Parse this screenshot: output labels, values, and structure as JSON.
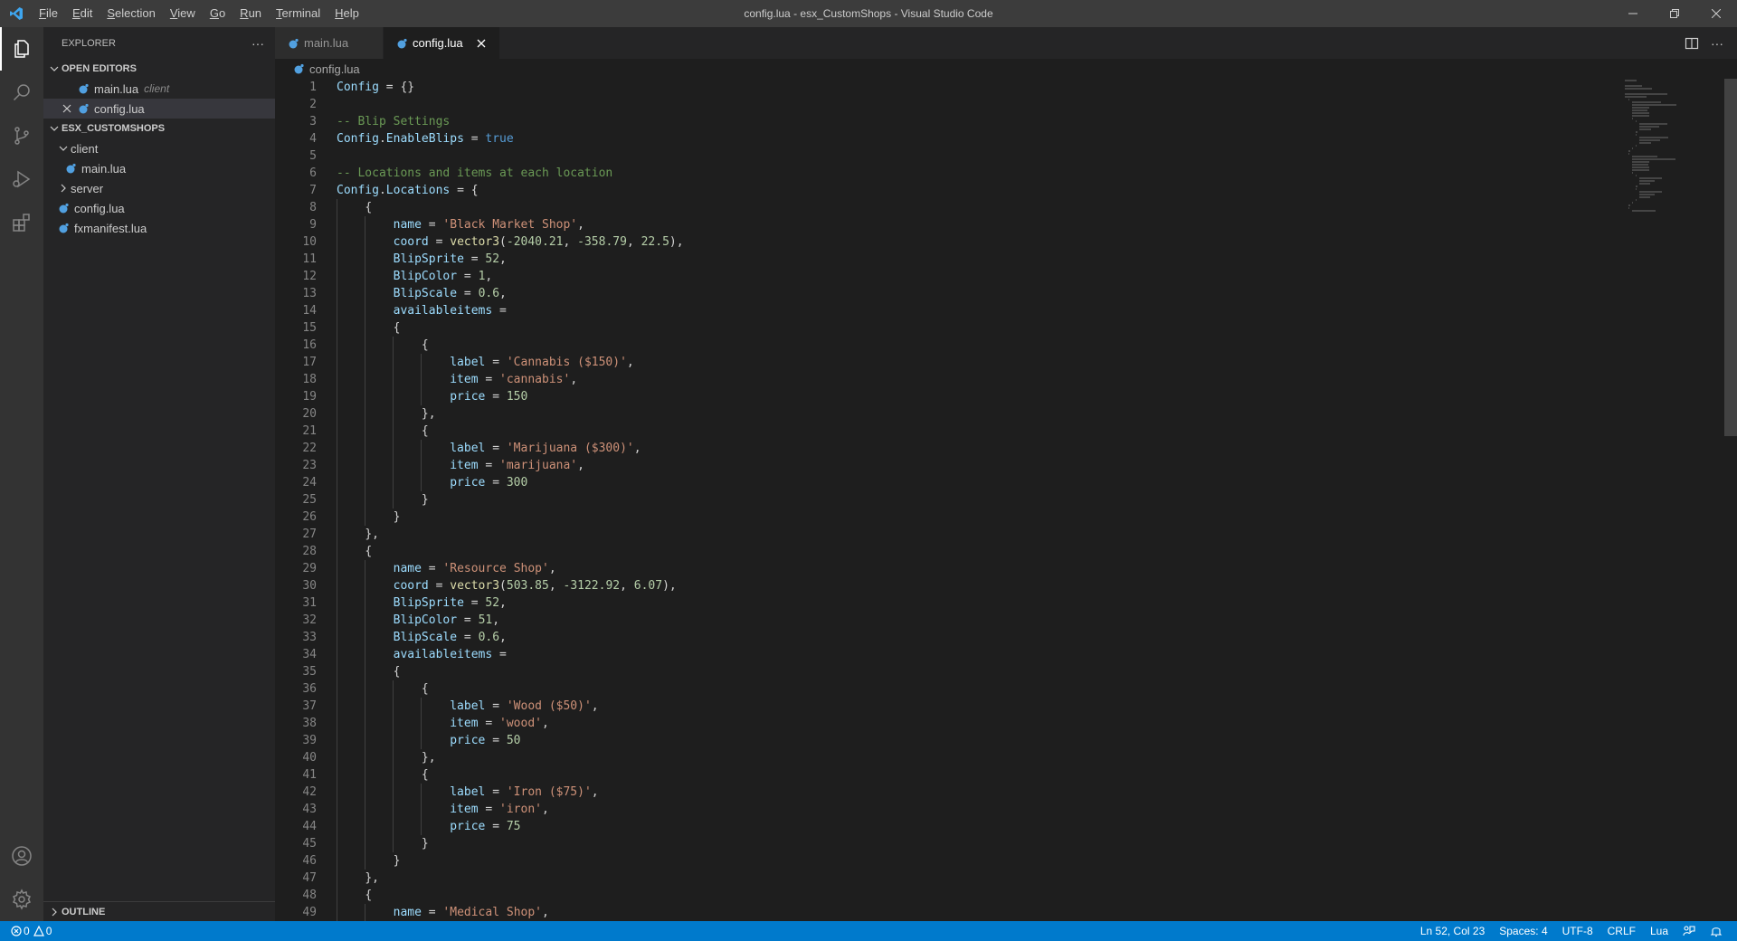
{
  "window": {
    "title": "config.lua - esx_CustomShops - Visual Studio Code",
    "accent": "#007acc"
  },
  "menu": [
    {
      "u": "F",
      "rest": "ile"
    },
    {
      "u": "E",
      "rest": "dit"
    },
    {
      "u": "S",
      "rest": "election"
    },
    {
      "u": "V",
      "rest": "iew"
    },
    {
      "u": "G",
      "rest": "o"
    },
    {
      "u": "R",
      "rest": "un"
    },
    {
      "u": "T",
      "rest": "erminal"
    },
    {
      "u": "H",
      "rest": "elp"
    }
  ],
  "sidebar": {
    "header": "EXPLORER",
    "open_editors_label": "OPEN EDITORS",
    "open_editors": [
      {
        "name": "main.lua",
        "desc": "client"
      },
      {
        "name": "config.lua",
        "desc": ""
      }
    ],
    "workspace_label": "ESX_CUSTOMSHOPS",
    "tree": {
      "client_folder": "client",
      "client_main": "main.lua",
      "server_folder": "server",
      "config": "config.lua",
      "fxmanifest": "fxmanifest.lua"
    },
    "outline_label": "OUTLINE"
  },
  "tabs": [
    {
      "label": "main.lua",
      "active": false
    },
    {
      "label": "config.lua",
      "active": true
    }
  ],
  "breadcrumb": "config.lua",
  "editor": {
    "lines": [
      {
        "indent": 0,
        "tokens": [
          [
            "v",
            "Config"
          ],
          [
            "p",
            " = {}"
          ]
        ]
      },
      {
        "indent": 0,
        "tokens": []
      },
      {
        "indent": 0,
        "tokens": [
          [
            "c",
            "-- Blip Settings"
          ]
        ]
      },
      {
        "indent": 0,
        "tokens": [
          [
            "v",
            "Config"
          ],
          [
            "p",
            "."
          ],
          [
            "f",
            "EnableBlips"
          ],
          [
            "p",
            " = "
          ],
          [
            "k",
            "true"
          ]
        ]
      },
      {
        "indent": 0,
        "tokens": []
      },
      {
        "indent": 0,
        "tokens": [
          [
            "c",
            "-- Locations and items at each location"
          ]
        ]
      },
      {
        "indent": 0,
        "tokens": [
          [
            "v",
            "Config"
          ],
          [
            "p",
            "."
          ],
          [
            "f",
            "Locations"
          ],
          [
            "p",
            " = {"
          ]
        ]
      },
      {
        "indent": 1,
        "tokens": [
          [
            "p",
            "{"
          ]
        ]
      },
      {
        "indent": 2,
        "tokens": [
          [
            "v",
            "name"
          ],
          [
            "p",
            " = "
          ],
          [
            "s",
            "'Black Market Shop'"
          ],
          [
            "p",
            ","
          ]
        ]
      },
      {
        "indent": 2,
        "tokens": [
          [
            "v",
            "coord"
          ],
          [
            "p",
            " = "
          ],
          [
            "fn",
            "vector3"
          ],
          [
            "p",
            "("
          ],
          [
            "n",
            "-2040.21"
          ],
          [
            "p",
            ", "
          ],
          [
            "n",
            "-358.79"
          ],
          [
            "p",
            ", "
          ],
          [
            "n",
            "22.5"
          ],
          [
            "p",
            "),"
          ]
        ]
      },
      {
        "indent": 2,
        "tokens": [
          [
            "v",
            "BlipSprite"
          ],
          [
            "p",
            " = "
          ],
          [
            "n",
            "52"
          ],
          [
            "p",
            ","
          ]
        ]
      },
      {
        "indent": 2,
        "tokens": [
          [
            "v",
            "BlipColor"
          ],
          [
            "p",
            " = "
          ],
          [
            "n",
            "1"
          ],
          [
            "p",
            ","
          ]
        ]
      },
      {
        "indent": 2,
        "tokens": [
          [
            "v",
            "BlipScale"
          ],
          [
            "p",
            " = "
          ],
          [
            "n",
            "0.6"
          ],
          [
            "p",
            ","
          ]
        ]
      },
      {
        "indent": 2,
        "tokens": [
          [
            "v",
            "availableitems"
          ],
          [
            "p",
            " ="
          ]
        ]
      },
      {
        "indent": 2,
        "tokens": [
          [
            "p",
            "{"
          ]
        ]
      },
      {
        "indent": 3,
        "tokens": [
          [
            "p",
            "{"
          ]
        ]
      },
      {
        "indent": 4,
        "tokens": [
          [
            "v",
            "label"
          ],
          [
            "p",
            " = "
          ],
          [
            "s",
            "'Cannabis ($150)'"
          ],
          [
            "p",
            ","
          ]
        ]
      },
      {
        "indent": 4,
        "tokens": [
          [
            "v",
            "item"
          ],
          [
            "p",
            " = "
          ],
          [
            "s",
            "'cannabis'"
          ],
          [
            "p",
            ","
          ]
        ]
      },
      {
        "indent": 4,
        "tokens": [
          [
            "v",
            "price"
          ],
          [
            "p",
            " = "
          ],
          [
            "n",
            "150"
          ]
        ]
      },
      {
        "indent": 3,
        "tokens": [
          [
            "p",
            "},"
          ]
        ]
      },
      {
        "indent": 3,
        "tokens": [
          [
            "p",
            "{"
          ]
        ]
      },
      {
        "indent": 4,
        "tokens": [
          [
            "v",
            "label"
          ],
          [
            "p",
            " = "
          ],
          [
            "s",
            "'Marijuana ($300)'"
          ],
          [
            "p",
            ","
          ]
        ]
      },
      {
        "indent": 4,
        "tokens": [
          [
            "v",
            "item"
          ],
          [
            "p",
            " = "
          ],
          [
            "s",
            "'marijuana'"
          ],
          [
            "p",
            ","
          ]
        ]
      },
      {
        "indent": 4,
        "tokens": [
          [
            "v",
            "price"
          ],
          [
            "p",
            " = "
          ],
          [
            "n",
            "300"
          ]
        ]
      },
      {
        "indent": 3,
        "tokens": [
          [
            "p",
            "}"
          ]
        ]
      },
      {
        "indent": 2,
        "tokens": [
          [
            "p",
            "}"
          ]
        ]
      },
      {
        "indent": 1,
        "tokens": [
          [
            "p",
            "},"
          ]
        ]
      },
      {
        "indent": 1,
        "tokens": [
          [
            "p",
            "{"
          ]
        ]
      },
      {
        "indent": 2,
        "tokens": [
          [
            "v",
            "name"
          ],
          [
            "p",
            " = "
          ],
          [
            "s",
            "'Resource Shop'"
          ],
          [
            "p",
            ","
          ]
        ]
      },
      {
        "indent": 2,
        "tokens": [
          [
            "v",
            "coord"
          ],
          [
            "p",
            " = "
          ],
          [
            "fn",
            "vector3"
          ],
          [
            "p",
            "("
          ],
          [
            "n",
            "503.85"
          ],
          [
            "p",
            ", "
          ],
          [
            "n",
            "-3122.92"
          ],
          [
            "p",
            ", "
          ],
          [
            "n",
            "6.07"
          ],
          [
            "p",
            "),"
          ]
        ]
      },
      {
        "indent": 2,
        "tokens": [
          [
            "v",
            "BlipSprite"
          ],
          [
            "p",
            " = "
          ],
          [
            "n",
            "52"
          ],
          [
            "p",
            ","
          ]
        ]
      },
      {
        "indent": 2,
        "tokens": [
          [
            "v",
            "BlipColor"
          ],
          [
            "p",
            " = "
          ],
          [
            "n",
            "51"
          ],
          [
            "p",
            ","
          ]
        ]
      },
      {
        "indent": 2,
        "tokens": [
          [
            "v",
            "BlipScale"
          ],
          [
            "p",
            " = "
          ],
          [
            "n",
            "0.6"
          ],
          [
            "p",
            ","
          ]
        ]
      },
      {
        "indent": 2,
        "tokens": [
          [
            "v",
            "availableitems"
          ],
          [
            "p",
            " ="
          ]
        ]
      },
      {
        "indent": 2,
        "tokens": [
          [
            "p",
            "{"
          ]
        ]
      },
      {
        "indent": 3,
        "tokens": [
          [
            "p",
            "{"
          ]
        ]
      },
      {
        "indent": 4,
        "tokens": [
          [
            "v",
            "label"
          ],
          [
            "p",
            " = "
          ],
          [
            "s",
            "'Wood ($50)'"
          ],
          [
            "p",
            ","
          ]
        ]
      },
      {
        "indent": 4,
        "tokens": [
          [
            "v",
            "item"
          ],
          [
            "p",
            " = "
          ],
          [
            "s",
            "'wood'"
          ],
          [
            "p",
            ","
          ]
        ]
      },
      {
        "indent": 4,
        "tokens": [
          [
            "v",
            "price"
          ],
          [
            "p",
            " = "
          ],
          [
            "n",
            "50"
          ]
        ]
      },
      {
        "indent": 3,
        "tokens": [
          [
            "p",
            "},"
          ]
        ]
      },
      {
        "indent": 3,
        "tokens": [
          [
            "p",
            "{"
          ]
        ]
      },
      {
        "indent": 4,
        "tokens": [
          [
            "v",
            "label"
          ],
          [
            "p",
            " = "
          ],
          [
            "s",
            "'Iron ($75)'"
          ],
          [
            "p",
            ","
          ]
        ]
      },
      {
        "indent": 4,
        "tokens": [
          [
            "v",
            "item"
          ],
          [
            "p",
            " = "
          ],
          [
            "s",
            "'iron'"
          ],
          [
            "p",
            ","
          ]
        ]
      },
      {
        "indent": 4,
        "tokens": [
          [
            "v",
            "price"
          ],
          [
            "p",
            " = "
          ],
          [
            "n",
            "75"
          ]
        ]
      },
      {
        "indent": 3,
        "tokens": [
          [
            "p",
            "}"
          ]
        ]
      },
      {
        "indent": 2,
        "tokens": [
          [
            "p",
            "}"
          ]
        ]
      },
      {
        "indent": 1,
        "tokens": [
          [
            "p",
            "},"
          ]
        ]
      },
      {
        "indent": 1,
        "tokens": [
          [
            "p",
            "{"
          ]
        ]
      },
      {
        "indent": 2,
        "tokens": [
          [
            "v",
            "name"
          ],
          [
            "p",
            " = "
          ],
          [
            "s",
            "'Medical Shop'"
          ],
          [
            "p",
            ","
          ]
        ]
      }
    ],
    "colors": {
      "v": "#9cdcfe",
      "p": "#d4d4d4",
      "c": "#6a9955",
      "f": "#9cdcfe",
      "k": "#569cd6",
      "s": "#ce9178",
      "n": "#b5cea8",
      "fn": "#dcdcaa"
    }
  },
  "status": {
    "errors": "0",
    "warnings": "0",
    "position": "Ln 52, Col 23",
    "spaces": "Spaces: 4",
    "encoding": "UTF-8",
    "eol": "CRLF",
    "language": "Lua"
  }
}
